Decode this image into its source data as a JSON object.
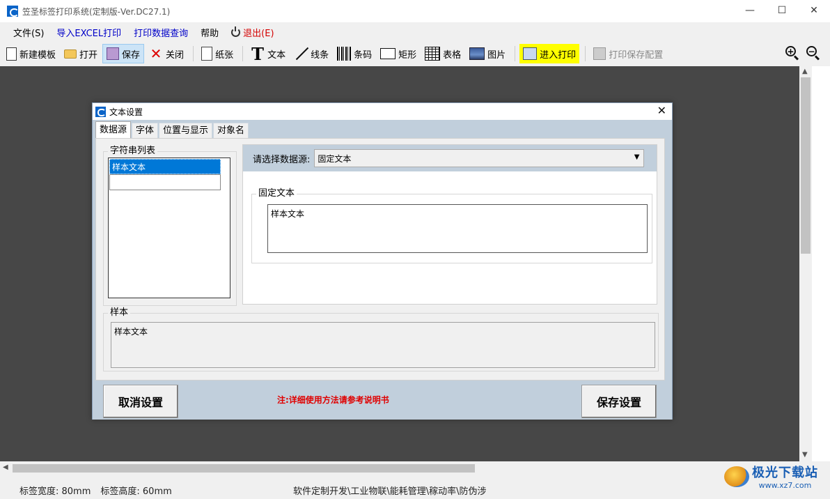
{
  "window": {
    "title": "笠圣标签打印系统(定制版-Ver.DC27.1)",
    "minimize": "—",
    "maximize": "☐",
    "close": "✕"
  },
  "menu": {
    "file": "文件(S)",
    "import_excel": "导入EXCEL打印",
    "print_query": "打印数据查询",
    "help": "帮助",
    "exit": "退出(E)"
  },
  "toolbar": {
    "new_template": "新建模板",
    "open": "打开",
    "save": "保存",
    "close": "关闭",
    "paper": "纸张",
    "text": "文本",
    "line": "线条",
    "barcode": "条码",
    "rect": "矩形",
    "table": "表格",
    "image": "图片",
    "enter_print": "进入打印",
    "print_save_config": "打印保存配置",
    "zoom_in": "+",
    "zoom_out": "−"
  },
  "dialog": {
    "title": "文本设置",
    "close": "✕",
    "tabs": [
      "数据源",
      "字体",
      "位置与显示",
      "对象名"
    ],
    "string_list_label": "字符串列表",
    "string_list_items": [
      "样本文本"
    ],
    "datasource_label": "请选择数据源:",
    "datasource_value": "固定文本",
    "fixed_text_label": "固定文本",
    "fixed_text_value": "样本文本",
    "sample_label": "样本",
    "sample_value": "样本文本",
    "cancel_button": "取消设置",
    "save_button": "保存设置",
    "note": "注:详细使用方法请参考说明书"
  },
  "status": {
    "label_width": "标签宽度: 80mm",
    "label_height": "标签高度: 60mm",
    "services": "软件定制开发\\工业物联\\能耗管理\\稼动率\\防伪涉"
  },
  "watermark": {
    "name": "极光下载站",
    "url": "www.xz7.com"
  },
  "colors": {
    "workspace": "#474747",
    "dialog_frame": "#c1cfdc",
    "accent_blue": "#0078d7",
    "note_red": "#e00000",
    "print_highlight": "#ffff00"
  }
}
